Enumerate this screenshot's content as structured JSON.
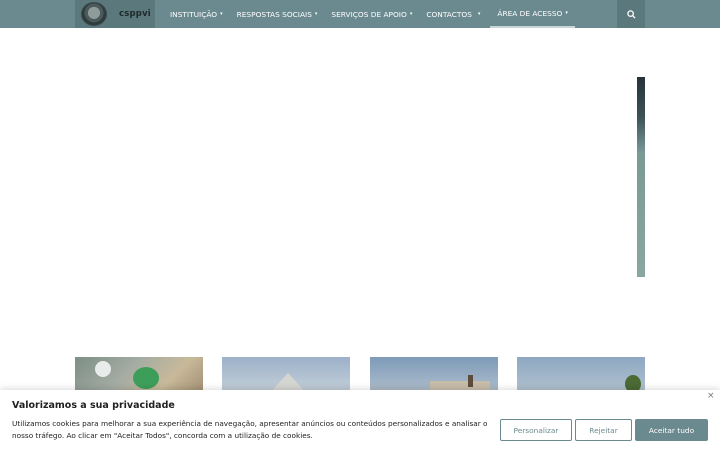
{
  "brand": {
    "name": "csppvi",
    "logo_icon": "crest-logo-icon"
  },
  "nav": {
    "items": [
      {
        "label": "INSTITUIÇÃO",
        "caret": "▾"
      },
      {
        "label": "RESPOSTAS SOCIAIS",
        "caret": "▾"
      },
      {
        "label": "SERVIÇOS DE APOIO",
        "caret": "▾"
      },
      {
        "label": "CONTACTOS",
        "caret": "▾"
      },
      {
        "label": "ÁREA DE ACESSO",
        "caret": "▾"
      }
    ],
    "active_item": "ÁREA DE ACESSO",
    "search_icon": "search-icon"
  },
  "colors": {
    "nav_bg": "#6b8a8f",
    "brand_bg": "#5b787c",
    "accent": "#6b8a8f"
  },
  "cookie": {
    "title": "Valorizamos a sua privacidade",
    "text": "Utilizamos cookies para melhorar a sua experiência de navegação, apresentar anúncios ou conteúdos personalizados e analisar o nosso tráfego. Ao clicar em \"Aceitar Todos\", concorda com a utilização de cookies.",
    "close": "×",
    "buttons": {
      "customize": "Personalizar",
      "reject": "Rejeitar",
      "accept": "Aceitar tudo"
    }
  }
}
